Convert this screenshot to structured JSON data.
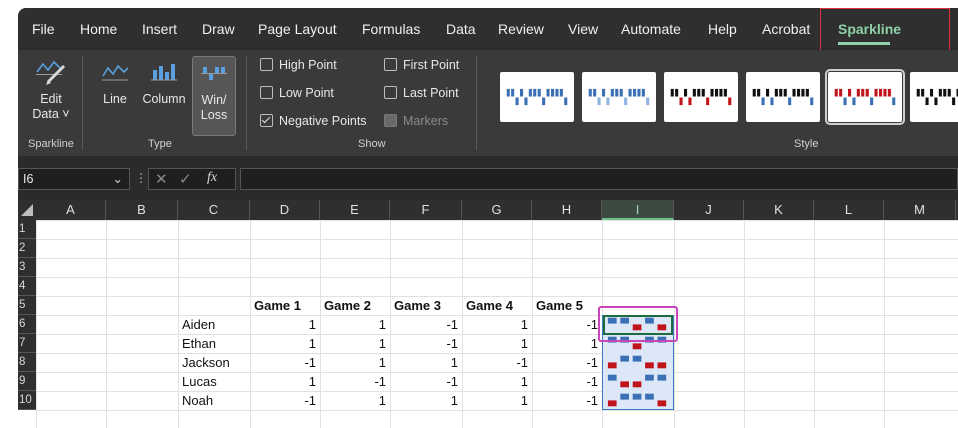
{
  "menu": {
    "items": [
      "File",
      "Home",
      "Insert",
      "Draw",
      "Page Layout",
      "Formulas",
      "Data",
      "Review",
      "View",
      "Automate",
      "Help",
      "Acrobat",
      "Sparkline"
    ],
    "active": "Sparkline"
  },
  "ribbon": {
    "sparkline_group": {
      "label": "Sparkline",
      "edit_data_line1": "Edit",
      "edit_data_line2": "Data ˅"
    },
    "type_group": {
      "label": "Type",
      "line": "Line",
      "column": "Column",
      "winloss_line1": "Win/",
      "winloss_line2": "Loss",
      "selected": "Win/Loss"
    },
    "show_group": {
      "label": "Show",
      "options": [
        {
          "label": "High Point",
          "checked": false,
          "disabled": false
        },
        {
          "label": "Low Point",
          "checked": false,
          "disabled": false
        },
        {
          "label": "Negative Points",
          "checked": true,
          "disabled": false
        },
        {
          "label": "First Point",
          "checked": false,
          "disabled": false
        },
        {
          "label": "Last Point",
          "checked": false,
          "disabled": false
        },
        {
          "label": "Markers",
          "checked": false,
          "disabled": true
        }
      ]
    },
    "style_group": {
      "label": "Style",
      "tiles": [
        {
          "pos": "#3b6fb6",
          "neg": "#3b6fb6"
        },
        {
          "pos": "#3b6fb6",
          "neg": "#8fb4e0"
        },
        {
          "pos": "#111111",
          "neg": "#c0141c"
        },
        {
          "pos": "#111111",
          "neg": "#3b6fb6"
        },
        {
          "pos": "#c0141c",
          "neg": "#3b6fb6"
        },
        {
          "pos": "#111111",
          "neg": "#111111"
        }
      ],
      "selected_index": 4
    }
  },
  "formula_bar": {
    "name_box": "I6",
    "fx": "fx",
    "formula": ""
  },
  "sheet": {
    "columns": [
      "A",
      "B",
      "C",
      "D",
      "E",
      "F",
      "G",
      "H",
      "I",
      "J",
      "K",
      "L",
      "M"
    ],
    "active_column": "I",
    "rows": [
      "1",
      "2",
      "3",
      "4",
      "5",
      "6",
      "7",
      "8",
      "9",
      "10"
    ],
    "headers": [
      "Game 1",
      "Game 2",
      "Game 3",
      "Game 4",
      "Game 5"
    ],
    "players": [
      {
        "name": "Aiden",
        "scores": [
          "1",
          "1",
          "-1",
          "1",
          "-1"
        ],
        "win_loss": [
          1,
          1,
          -1,
          1,
          -1
        ]
      },
      {
        "name": "Ethan",
        "scores": [
          "1",
          "1",
          "-1",
          "1",
          "1"
        ],
        "win_loss": [
          1,
          1,
          -1,
          1,
          1
        ]
      },
      {
        "name": "Jackson",
        "scores": [
          "-1",
          "1",
          "1",
          "-1",
          "-1"
        ],
        "win_loss": [
          -1,
          1,
          1,
          -1,
          -1
        ]
      },
      {
        "name": "Lucas",
        "scores": [
          "1",
          "-1",
          "-1",
          "1",
          "-1"
        ],
        "win_loss": [
          1,
          -1,
          -1,
          1,
          1
        ]
      },
      {
        "name": "Noah",
        "scores": [
          "-1",
          "1",
          "1",
          "1",
          "-1"
        ],
        "win_loss": [
          -1,
          1,
          1,
          1,
          -1
        ]
      }
    ],
    "sparkline_colors": {
      "win": "#3b6fb6",
      "loss": "#c0141c"
    }
  }
}
